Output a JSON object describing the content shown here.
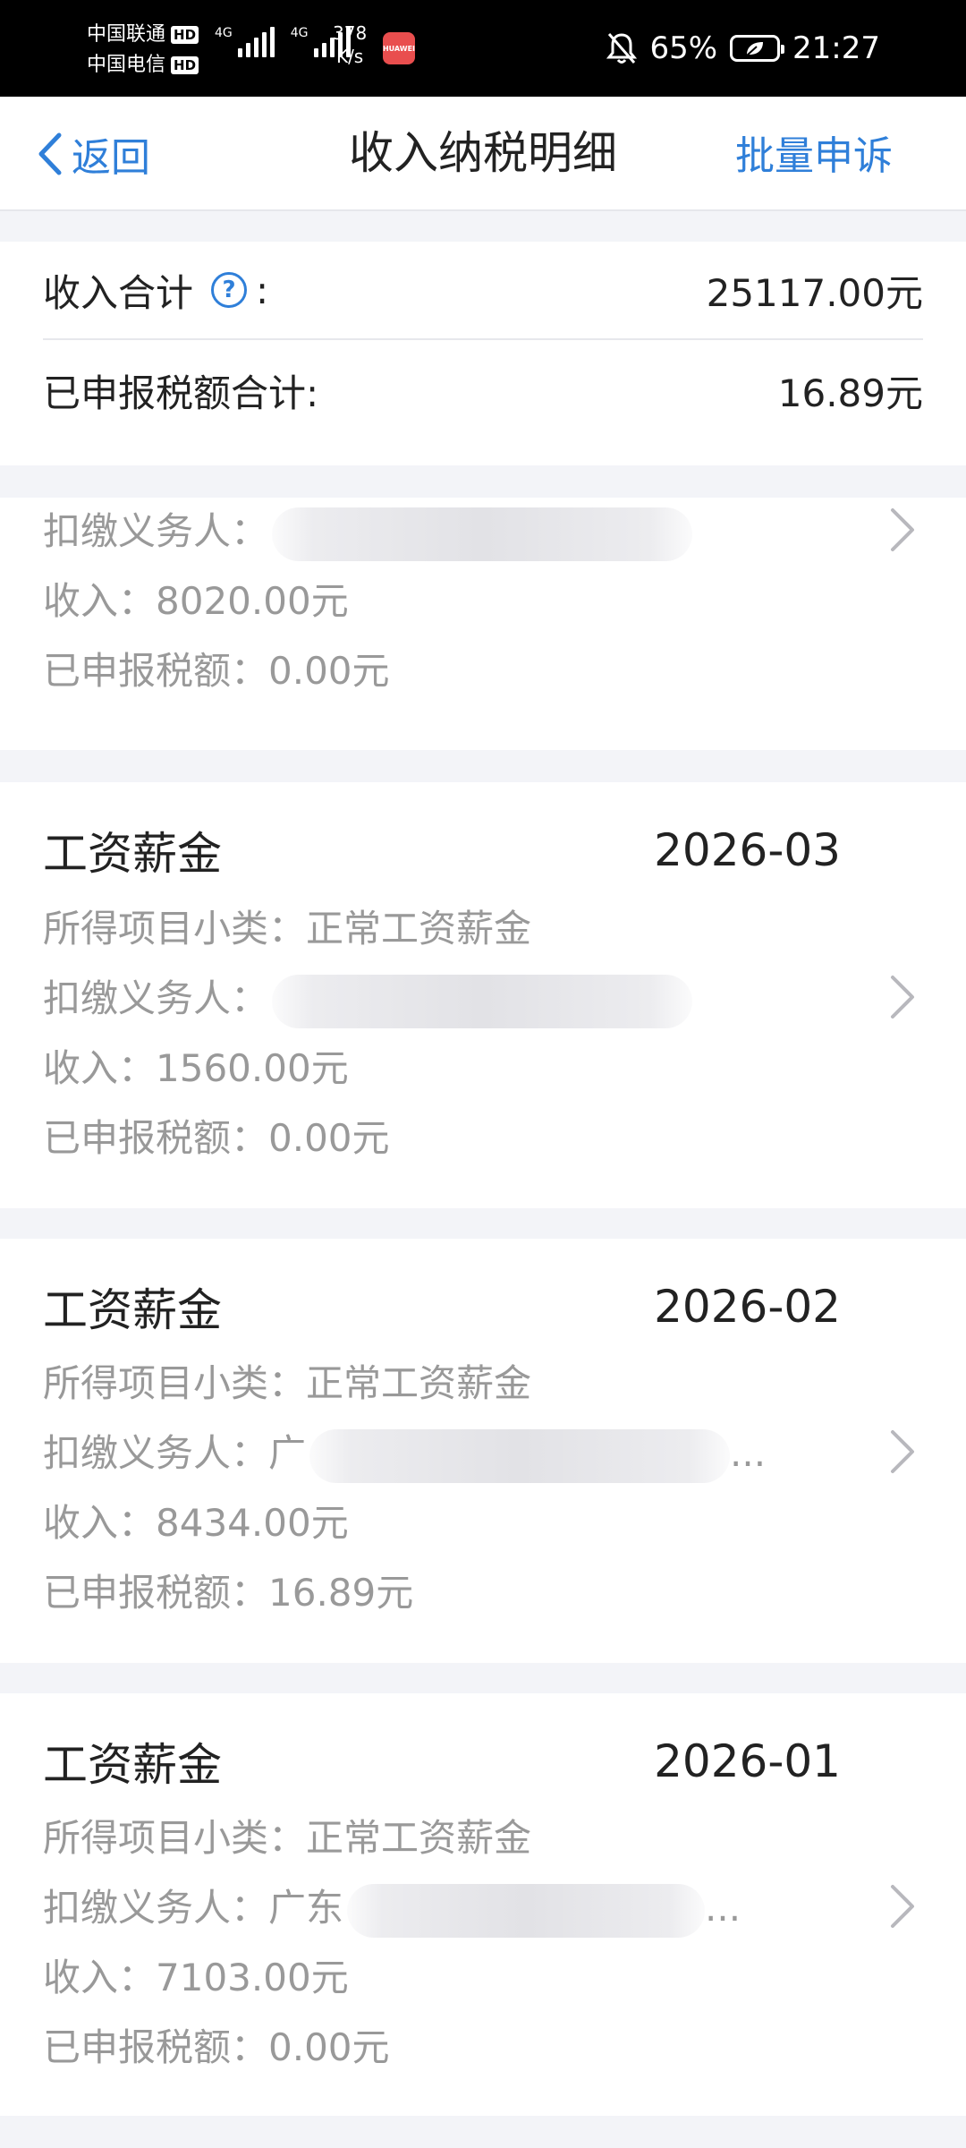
{
  "status_bar": {
    "carrier_1": "中国联通",
    "carrier_2": "中国电信",
    "hd_label": "HD",
    "net_tag": "4G",
    "speed_value": "378",
    "speed_unit": "K/s",
    "app_icon_label": "HUAWEI",
    "battery_percent": "65%",
    "time": "21:27"
  },
  "nav": {
    "back_label": "返回",
    "title": "收入纳税明细",
    "batch_appeal_label": "批量申诉"
  },
  "summary": {
    "income_label": "收入合计",
    "income_colon": ":",
    "help_symbol": "?",
    "income_value": "25117.00元",
    "tax_label": "已申报税额合计:",
    "tax_value": "16.89元"
  },
  "labels": {
    "withholder": "扣缴义务人：",
    "income": "收入：",
    "tax": "已申报税额：",
    "subcategory": "所得项目小类："
  },
  "records": [
    {
      "withholder_visible": "",
      "withholder_tail": "",
      "income": "8020.00元",
      "tax": "0.00元"
    },
    {
      "type": "工资薪金",
      "period": "2026-03",
      "subcategory": "正常工资薪金",
      "withholder_visible": "",
      "withholder_tail": "",
      "income": "1560.00元",
      "tax": "0.00元"
    },
    {
      "type": "工资薪金",
      "period": "2026-02",
      "subcategory": "正常工资薪金",
      "withholder_visible": "广",
      "withholder_tail": "...",
      "income": "8434.00元",
      "tax": "16.89元"
    },
    {
      "type": "工资薪金",
      "period": "2026-01",
      "subcategory": "正常工资薪金",
      "withholder_visible": "广东",
      "withholder_tail": "...",
      "income": "7103.00元",
      "tax": "0.00元"
    }
  ],
  "colors": {
    "accent": "#2f7fd9",
    "page_bg": "#f3f4f8",
    "muted_text": "#999999"
  },
  "icons": [
    "back-chevron-icon",
    "help-circle-icon",
    "chevron-right-icon",
    "mute-bell-icon",
    "battery-icon"
  ]
}
